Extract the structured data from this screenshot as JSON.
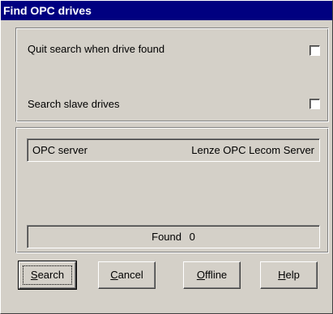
{
  "window": {
    "title": "Find OPC drives"
  },
  "options": [
    {
      "label": "Quit search when drive found",
      "checked": false
    },
    {
      "label": "Search slave drives",
      "checked": false
    }
  ],
  "server": {
    "label": "OPC server",
    "value": "Lenze OPC Lecom Server"
  },
  "found": {
    "label": "Found",
    "count": "0"
  },
  "buttons": {
    "search": {
      "underline": "S",
      "rest": "earch"
    },
    "cancel": {
      "underline": "C",
      "rest": "ancel"
    },
    "offline": {
      "underline": "O",
      "rest": "ffline"
    },
    "help": {
      "underline": "H",
      "rest": "elp"
    }
  }
}
